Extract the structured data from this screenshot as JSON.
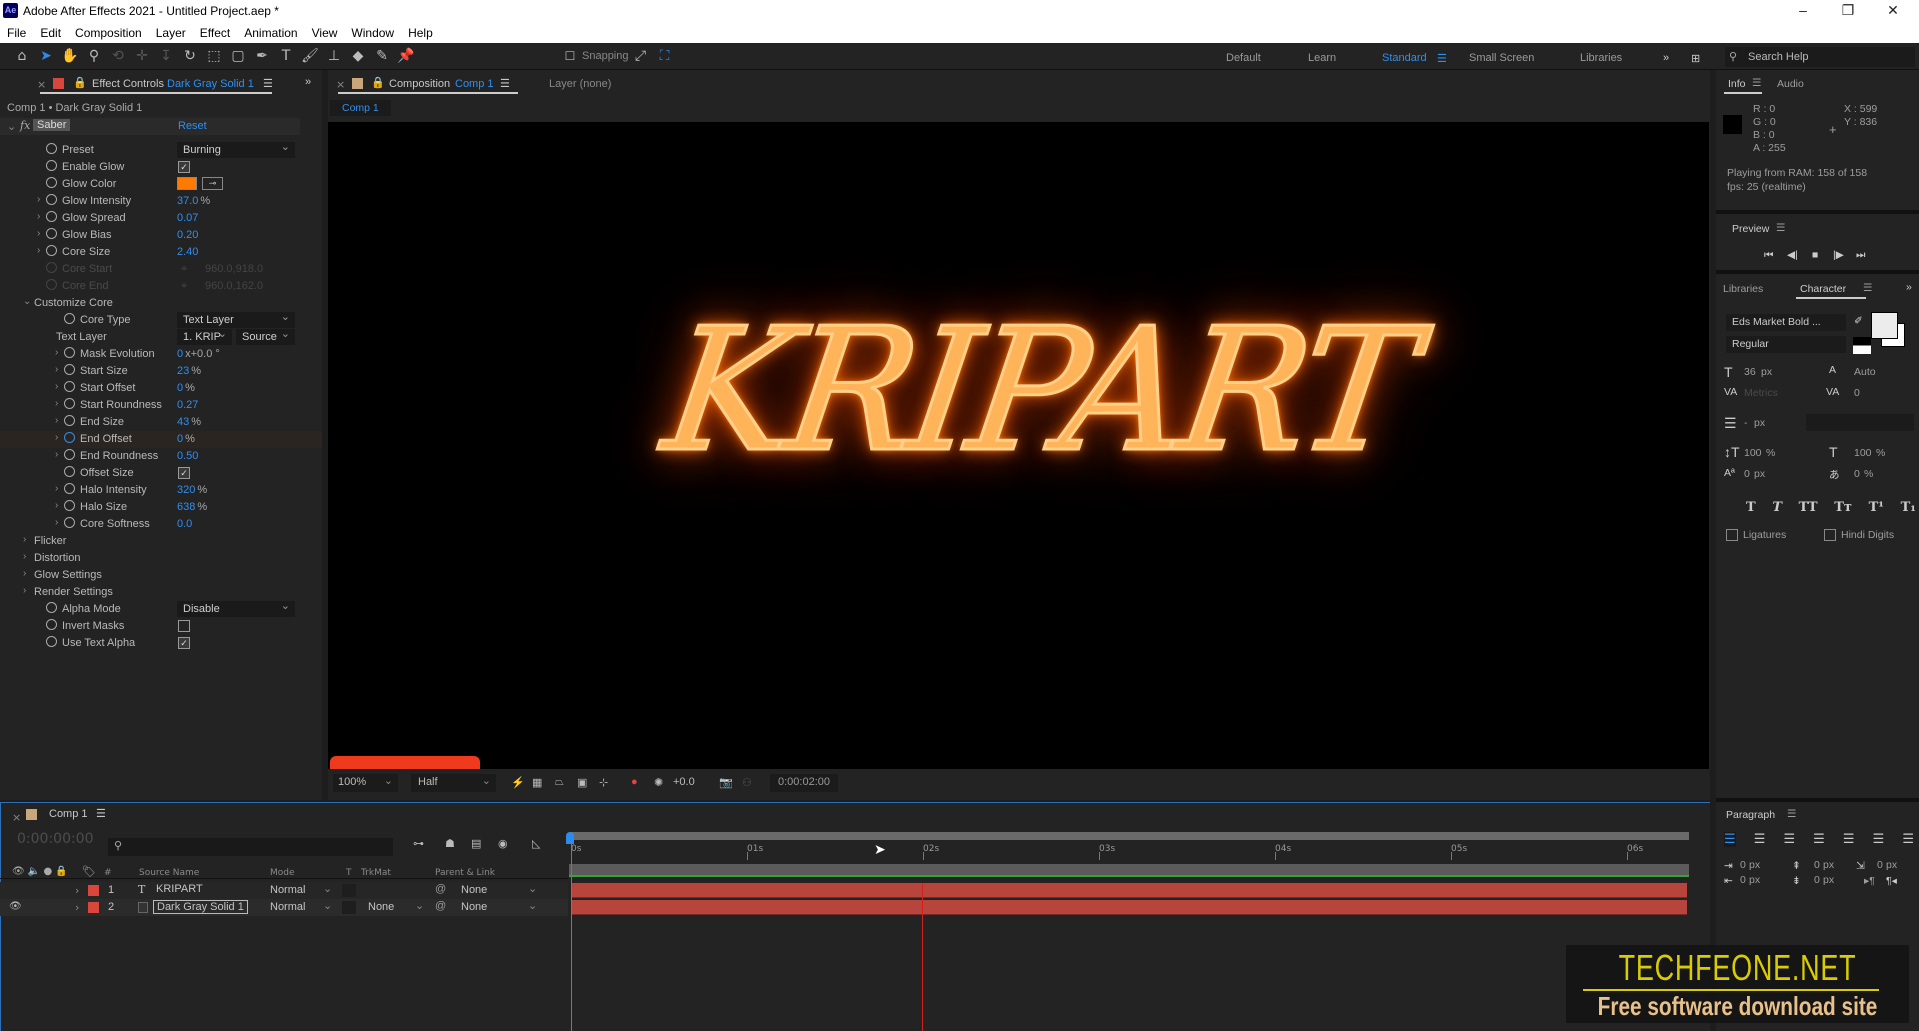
{
  "app": {
    "title": "Adobe After Effects 2021 - Untitled Project.aep *",
    "logo": "Ae"
  },
  "menu": [
    "File",
    "Edit",
    "Composition",
    "Layer",
    "Effect",
    "Animation",
    "View",
    "Window",
    "Help"
  ],
  "toolbar": {
    "snapping": "Snapping",
    "workspaces": [
      "Default",
      "Learn",
      "Standard",
      "Small Screen",
      "Libraries"
    ],
    "active_workspace": "Standard",
    "search_placeholder": "Search Help"
  },
  "effect_controls": {
    "tab_label": "Effect Controls",
    "tab_layer": "Dark Gray Solid 1",
    "breadcrumb": "Comp 1 • Dark Gray Solid 1",
    "effect_name": "Saber",
    "reset": "Reset",
    "glow_color": "#ff7a00",
    "rows": [
      {
        "label": "Preset",
        "type": "dropdown",
        "value": "Burning",
        "indent": 1
      },
      {
        "label": "Enable Glow",
        "type": "check",
        "checked": true,
        "indent": 1
      },
      {
        "label": "Glow Color",
        "type": "color",
        "indent": 1
      },
      {
        "label": "Glow Intensity",
        "type": "num",
        "value": "37.0",
        "unit": "%",
        "indent": 1,
        "twirl": true
      },
      {
        "label": "Glow Spread",
        "type": "num",
        "value": "0.07",
        "indent": 1,
        "twirl": true
      },
      {
        "label": "Glow Bias",
        "type": "num",
        "value": "0.20",
        "indent": 1,
        "twirl": true
      },
      {
        "label": "Core Size",
        "type": "num",
        "value": "2.40",
        "indent": 1,
        "twirl": true
      },
      {
        "label": "Core Start",
        "type": "point",
        "value": "960.0,918.0",
        "indent": 1,
        "disabled": true
      },
      {
        "label": "Core End",
        "type": "point",
        "value": "960.0,162.0",
        "indent": 1,
        "disabled": true
      },
      {
        "label": "Customize Core",
        "type": "section",
        "indent": 0,
        "open": true
      },
      {
        "label": "Core Type",
        "type": "dropdown",
        "value": "Text Layer",
        "indent": 2
      },
      {
        "label": "Text Layer",
        "type": "dual",
        "value": "1. KRIP",
        "value2": "Source",
        "indent": 2,
        "nosw": true
      },
      {
        "label": "Mask Evolution",
        "type": "num",
        "value": "0",
        "unit": "x+0.0 °",
        "indent": 2,
        "twirl": true
      },
      {
        "label": "Start Size",
        "type": "num",
        "value": "23",
        "unit": "%",
        "indent": 2,
        "twirl": true
      },
      {
        "label": "Start Offset",
        "type": "num",
        "value": "0",
        "unit": "%",
        "indent": 2,
        "twirl": true
      },
      {
        "label": "Start Roundness",
        "type": "num",
        "value": "0.27",
        "indent": 2,
        "twirl": true
      },
      {
        "label": "End Size",
        "type": "num",
        "value": "43",
        "unit": "%",
        "indent": 2,
        "twirl": true
      },
      {
        "label": "End Offset",
        "type": "num",
        "value": "0",
        "unit": "%",
        "indent": 2,
        "twirl": true,
        "keyed": true
      },
      {
        "label": "End Roundness",
        "type": "num",
        "value": "0.50",
        "indent": 2,
        "twirl": true
      },
      {
        "label": "Offset Size",
        "type": "check",
        "checked": true,
        "indent": 2
      },
      {
        "label": "Halo Intensity",
        "type": "num",
        "value": "320",
        "unit": "%",
        "indent": 2,
        "twirl": true
      },
      {
        "label": "Halo Size",
        "type": "num",
        "value": "638",
        "unit": "%",
        "indent": 2,
        "twirl": true
      },
      {
        "label": "Core Softness",
        "type": "num",
        "value": "0.0",
        "indent": 2,
        "twirl": true
      },
      {
        "label": "Flicker",
        "type": "section",
        "indent": 0
      },
      {
        "label": "Distortion",
        "type": "section",
        "indent": 0
      },
      {
        "label": "Glow Settings",
        "type": "section",
        "indent": 0
      },
      {
        "label": "Render Settings",
        "type": "section",
        "indent": 0
      },
      {
        "label": "Alpha Mode",
        "type": "dropdown",
        "value": "Disable",
        "indent": 1
      },
      {
        "label": "Invert Masks",
        "type": "check",
        "checked": false,
        "indent": 1
      },
      {
        "label": "Use Text Alpha",
        "type": "check",
        "checked": true,
        "indent": 1
      }
    ]
  },
  "composition": {
    "tab_label": "Composition",
    "tab_comp": "Comp 1",
    "layer_tab": "Layer (none)",
    "sub_tab": "Comp 1",
    "viewer_text": "KRIPART",
    "zoom": "100%",
    "resolution": "Half",
    "exposure": "+0.0",
    "timecode": "0:00:02:00"
  },
  "timeline": {
    "tab": "Comp 1",
    "timecode": "0:00:00:00",
    "columns": {
      "source": "Source Name",
      "mode": "Mode",
      "t": "T",
      "trkmat": "TrkMat",
      "parent": "Parent & Link",
      "num": "#"
    },
    "ruler": [
      "0s",
      "01s",
      "02s",
      "03s",
      "04s",
      "05s",
      "06s"
    ],
    "layers": [
      {
        "num": "1",
        "type_icon": "T",
        "name": "KRIPART",
        "mode": "Normal",
        "trkmat": "",
        "parent": "None",
        "color": "#d9463b"
      },
      {
        "num": "2",
        "type_icon": "solid",
        "name": "Dark Gray Solid 1",
        "mode": "Normal",
        "trkmat": "None",
        "parent": "None",
        "color": "#d9463b"
      }
    ]
  },
  "info": {
    "tab": "Info",
    "tab2": "Audio",
    "r": "R : 0",
    "g": "G : 0",
    "b": "B : 0",
    "a": "A : 255",
    "x": "X : 599",
    "y": "Y : 836",
    "status1": "Playing from RAM: 158 of 158",
    "status2": "fps: 25 (realtime)"
  },
  "preview": {
    "tab": "Preview"
  },
  "character": {
    "tab1": "Libraries",
    "tab2": "Character",
    "font": "Eds Market Bold ...",
    "style": "Regular",
    "size": "36",
    "size_unit": "px",
    "leading": "Auto",
    "kerning": "Metrics",
    "tracking": "0",
    "stroke": "-",
    "stroke_unit": "px",
    "vscale": "100",
    "hscale": "100",
    "baseline": "0",
    "baseline_unit": "px",
    "tsume": "0",
    "pct": "%",
    "ligatures": "Ligatures",
    "hindi": "Hindi Digits"
  },
  "paragraph": {
    "tab": "Paragraph",
    "v1": "0",
    "v2": "0",
    "v3": "0",
    "v4": "0",
    "v5": "0",
    "unit": "px"
  },
  "watermark": {
    "title": "TECHFEONE.NET",
    "subtitle": "Free software download site"
  }
}
